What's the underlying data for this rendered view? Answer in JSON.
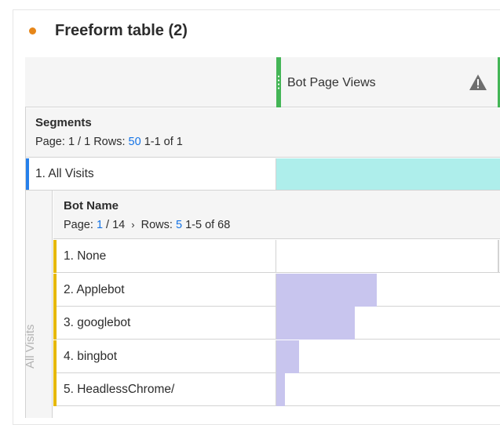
{
  "panel": {
    "title": "Freeform table (2)"
  },
  "column": {
    "title": "Bot Page Views",
    "warning_icon": "warning-triangle-icon"
  },
  "segments": {
    "title": "Segments",
    "page_label": "Page:",
    "page_value": "1 / 1",
    "rows_label": "Rows:",
    "rows_value": "50",
    "range": "1-1 of 1"
  },
  "all_visits_row": {
    "label": "1.  All Visits",
    "bar_fraction": 1.0
  },
  "side_label": "All Visits",
  "bot_name": {
    "title": "Bot Name",
    "page_label": "Page:",
    "page_current": "1",
    "page_total": "/ 14",
    "next_icon": "chevron-right-icon",
    "rows_label": "Rows:",
    "rows_value": "5",
    "range": "1-5 of 68"
  },
  "bot_rows": [
    {
      "label": "1.  None",
      "bar_fraction": 0.0
    },
    {
      "label": "2.  Applebot",
      "bar_fraction": 0.45
    },
    {
      "label": "3.  googlebot",
      "bar_fraction": 0.35
    },
    {
      "label": "4.  bingbot",
      "bar_fraction": 0.1
    },
    {
      "label": "5.  HeadlessChrome/",
      "bar_fraction": 0.04
    }
  ],
  "colors": {
    "accent_orange": "#e68619",
    "column_green": "#44b556",
    "segment_blue": "#2680eb",
    "segment_bar": "#aeeeeb",
    "bot_accent": "#e6b800",
    "bot_bar": "#c8c5ee",
    "link_blue": "#1473e6"
  }
}
